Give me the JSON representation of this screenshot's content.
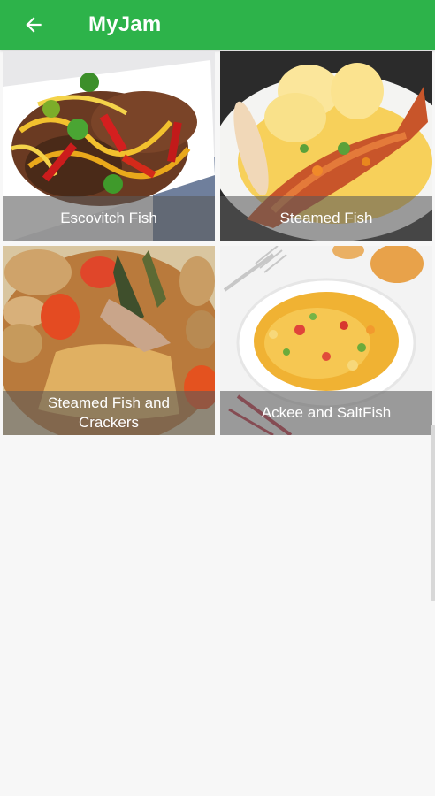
{
  "appbar": {
    "title": "MyJam",
    "back_icon": "arrow-left-icon"
  },
  "recipes": [
    {
      "label": "Escovitch Fish"
    },
    {
      "label": "Steamed Fish"
    },
    {
      "label": "Steamed Fish and Crackers"
    },
    {
      "label": "Ackee and SaltFish"
    }
  ],
  "colors": {
    "appbar": "#2db34a",
    "background": "#f7f7f7"
  }
}
